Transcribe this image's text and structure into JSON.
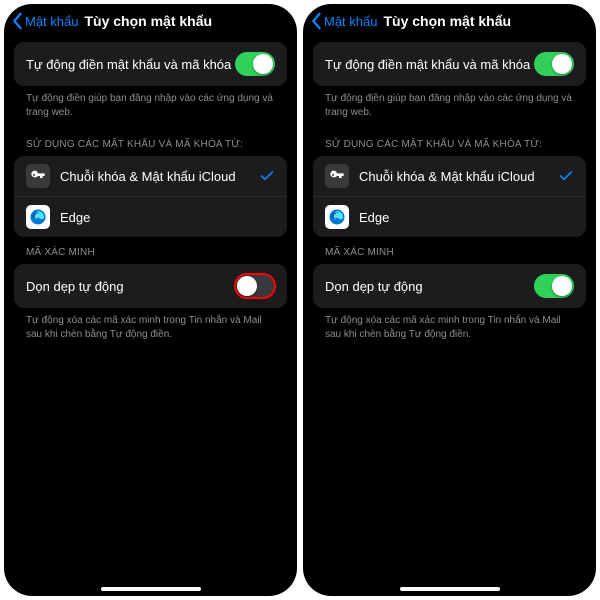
{
  "header": {
    "back_label": "Mật khẩu",
    "title": "Tùy chọn mật khẩu"
  },
  "autofill": {
    "label": "Tự động điền mật khẩu và mã khóa",
    "footer": "Tự động điền giúp bạn đăng nhập vào các ứng dụng và trang web."
  },
  "sources": {
    "header": "SỬ DỤNG CÁC MẬT KHẨU VÀ MÃ KHÓA TỪ:",
    "keychain_label": "Chuỗi khóa & Mật khẩu iCloud",
    "edge_label": "Edge"
  },
  "verification": {
    "header": "MÃ XÁC MINH",
    "cleanup_label": "Dọn dẹp tự động",
    "footer": "Tự động xóa các mã xác minh trong Tin nhắn và Mail sau khi chèn bằng Tự động điền."
  },
  "colors": {
    "accent": "#0a84ff",
    "toggle_on": "#30d158",
    "highlight": "#ff0000"
  }
}
